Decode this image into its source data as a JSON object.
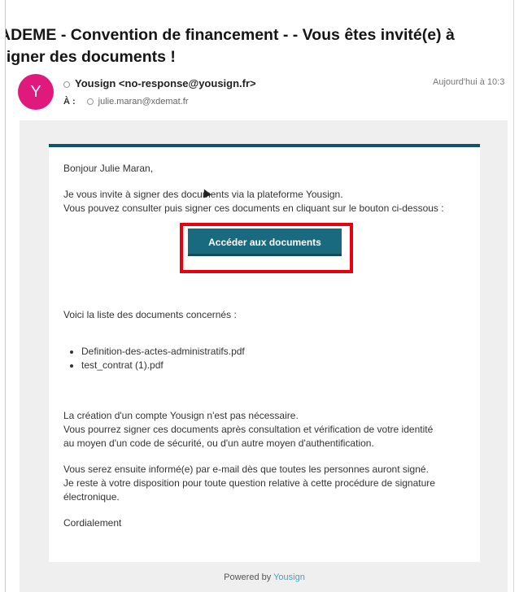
{
  "email": {
    "subject_line1": "ADEME - Convention de financement - - Vous êtes invité(e) à",
    "subject_line2": "signer des documents !",
    "avatar_letter": "Y",
    "avatar_color": "#e0197d",
    "from": "Yousign <no-response@yousign.fr>",
    "date": "Aujourd'hui à 10:3",
    "to_label": "À :",
    "to": "julie.maran@xdemat.fr"
  },
  "message": {
    "greeting": "Bonjour Julie Maran,",
    "invite_line1": "Je vous invite à signer des documents via la plateforme Yousign.",
    "invite_line2": "Vous pouvez consulter puis signer ces documents en cliquant sur le bouton ci-dessous :",
    "cta_label": "Accéder aux documents",
    "list_intro": "Voici la liste des documents concernés :",
    "documents": [
      "Definition-des-actes-administratifs.pdf",
      "test_contrat (1).pdf"
    ],
    "account_line1": "La création d'un compte Yousign n'est pas nécessaire.",
    "account_line2": "Vous pourrez signer ces documents après consultation et vérification de votre identité",
    "account_line3": "au moyen d'un code de sécurité, ou d'un autre moyen d'authentification.",
    "info_line1": "Vous serez ensuite informé(e) par e-mail dès que toutes les personnes auront signé.",
    "info_line2": "Je reste à votre disposition pour toute question relative à cette procédure de signature",
    "info_line3": "électronique.",
    "closing": "Cordialement"
  },
  "footer": {
    "powered_by": "Powered by",
    "brand": "Yousign"
  },
  "colors": {
    "accent": "#196a7f",
    "highlight": "#e8000d"
  }
}
